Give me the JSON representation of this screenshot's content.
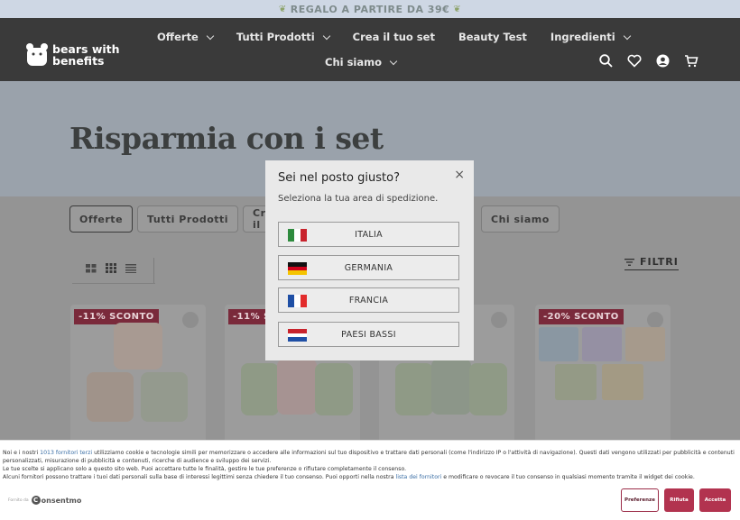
{
  "promo": {
    "text": "REGALO A PARTIRE DA 39€"
  },
  "header": {
    "logo_line1": "bears with",
    "logo_line2": "benefits",
    "nav": [
      {
        "label": "Offerte",
        "dropdown": true
      },
      {
        "label": "Tutti Prodotti",
        "dropdown": true
      },
      {
        "label": "Crea il tuo set",
        "dropdown": false
      },
      {
        "label": "Beauty Test",
        "dropdown": false
      },
      {
        "label": "Ingredienti",
        "dropdown": true
      },
      {
        "label": "Chi siamo",
        "dropdown": true
      }
    ],
    "icons": [
      "search-icon",
      "heart-icon",
      "account-icon",
      "cart-icon"
    ]
  },
  "hero": {
    "title": "Risparmia con i set"
  },
  "filter_pills": [
    "Offerte",
    "Tutti Prodotti",
    "Crea il",
    "Chi siamo"
  ],
  "filters_label": "FILTRI",
  "products": [
    {
      "badge": "-11% SCONTO"
    },
    {
      "badge": "-11% SC"
    },
    {
      "badge": ""
    },
    {
      "badge": "-20% SCONTO"
    }
  ],
  "modal": {
    "title": "Sei nel posto giusto?",
    "subtitle": "Seleziona la tua area di spedizione.",
    "close": "×",
    "countries": [
      {
        "label": "ITALIA",
        "flag": "it"
      },
      {
        "label": "GERMANIA",
        "flag": "de"
      },
      {
        "label": "FRANCIA",
        "flag": "fr"
      },
      {
        "label": "PAESI BASSI",
        "flag": "nl"
      }
    ]
  },
  "cookie": {
    "p1_a": "Noi e i nostri ",
    "p1_link": "1013 fornitori terzi",
    "p1_b": " utilizziamo cookie e tecnologie simili per memorizzare o accedere alle informazioni sul tuo dispositivo e trattare dati personali (come l'indirizzo IP o l'attività di navigazione). Questi dati vengono utilizzati per pubblicità e contenuti personalizzati, misurazione di pubblicità e contenuti, ricerche di audience e sviluppo dei servizi.",
    "p2": "Le tue scelte si applicano solo a questo sito web. Puoi accettare tutte le finalità, gestire le tue preferenze o rifiutare completamente il consenso.",
    "p3_a": "Alcuni fornitori possono trattare i tuoi dati personali sulla base di interessi legittimi senza chiedere il tuo consenso. Puoi opporti nella nostra ",
    "p3_link": "lista dei fornitori",
    "p3_b": " e modificare o revocare il tuo consenso in qualsiasi momento tramite il widget dei cookie.",
    "powered_by": "Fornito da",
    "brand": "onsentmo",
    "btn_preferences": "Preferenze",
    "btn_reject": "Rifiuta",
    "btn_accept": "Accetta"
  }
}
